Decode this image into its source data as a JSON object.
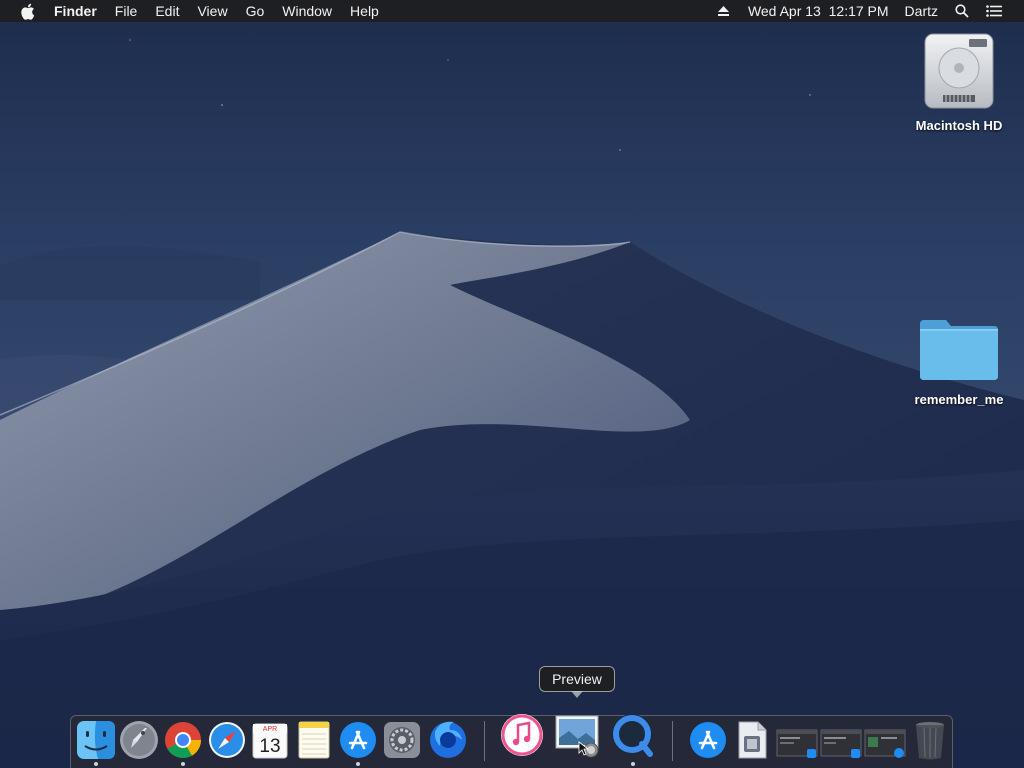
{
  "menubar": {
    "app_name": "Finder",
    "menus": [
      "File",
      "Edit",
      "View",
      "Go",
      "Window",
      "Help"
    ],
    "clock": "Wed Apr 13  12:17 PM",
    "user": "Dartz"
  },
  "desktop": {
    "icons": [
      {
        "label": "Macintosh HD",
        "icon": "hard-drive-icon"
      },
      {
        "label": "remember_me",
        "icon": "folder-icon"
      }
    ]
  },
  "tooltip": "Preview",
  "dock": {
    "apps": [
      {
        "name": "Finder",
        "icon": "finder-icon",
        "running": true
      },
      {
        "name": "Launchpad",
        "icon": "launchpad-icon",
        "running": false
      },
      {
        "name": "Google Chrome",
        "icon": "chrome-icon",
        "running": true
      },
      {
        "name": "Safari",
        "icon": "safari-icon",
        "running": false
      },
      {
        "name": "Calendar",
        "icon": "calendar-icon",
        "running": false
      },
      {
        "name": "Notes",
        "icon": "notes-icon",
        "running": false
      },
      {
        "name": "App Store",
        "icon": "app-store-icon",
        "running": true
      },
      {
        "name": "System Preferences",
        "icon": "system-preferences-icon",
        "running": false
      },
      {
        "name": "Firefox",
        "icon": "firefox-icon",
        "running": false
      },
      {
        "name": "iTunes",
        "icon": "itunes-icon",
        "running": false
      },
      {
        "name": "Preview",
        "icon": "preview-icon",
        "running": false
      },
      {
        "name": "QuickTime Player",
        "icon": "quicktime-icon",
        "running": true
      }
    ],
    "calendar": {
      "month": "APR",
      "day": "13"
    },
    "recents": [
      {
        "name": "App Store download",
        "icon": "app-store-folder-icon"
      },
      {
        "name": "Document",
        "icon": "document-icon"
      },
      {
        "name": "Window thumbnail 1",
        "icon": "window-thumbnail-icon"
      },
      {
        "name": "Window thumbnail 2",
        "icon": "window-thumbnail-icon"
      },
      {
        "name": "Window thumbnail 3",
        "icon": "window-thumbnail-icon"
      },
      {
        "name": "Trash",
        "icon": "trash-icon"
      }
    ]
  },
  "colors": {
    "menubar_bg": "#1e1e20",
    "folder_blue": "#5fb4e6",
    "wallpaper_top": "#1b2a4a"
  }
}
